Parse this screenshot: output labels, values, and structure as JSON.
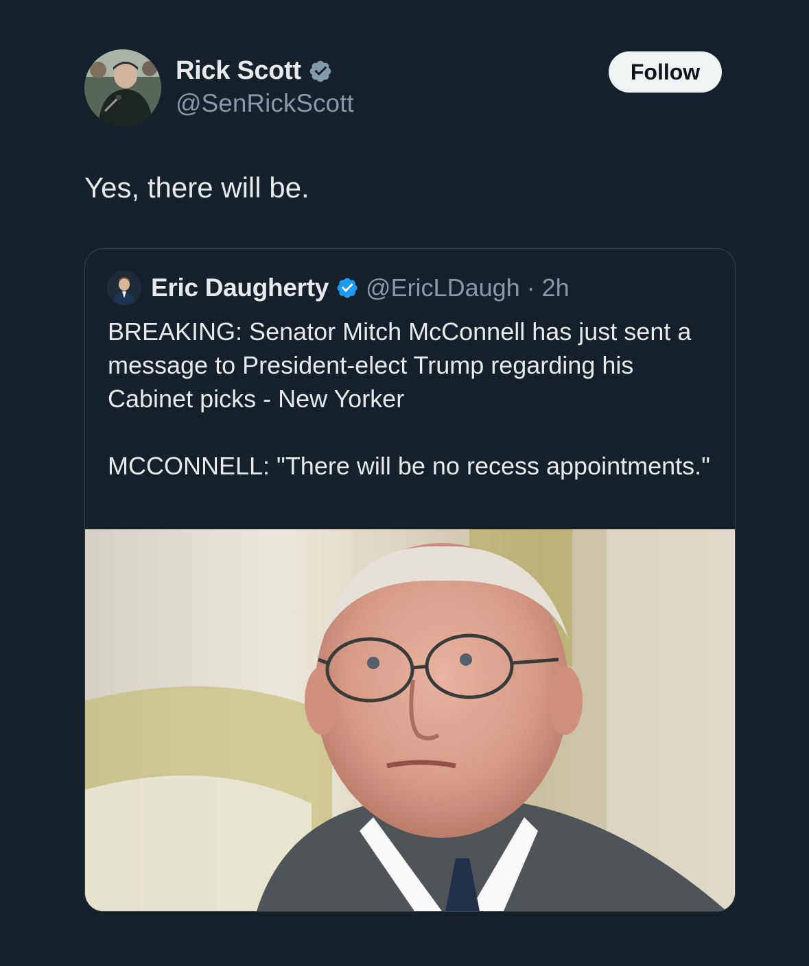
{
  "author": {
    "name": "Rick Scott",
    "handle": "@SenRickScott",
    "verified_badge": "gray-verified-badge-icon",
    "avatar": "avatar-photo"
  },
  "follow_button": {
    "label": "Follow"
  },
  "tweet": {
    "text": "Yes, there will be."
  },
  "quoted_tweet": {
    "author_name": "Eric Daugherty",
    "handle": "@EricLDaugh",
    "separator": "·",
    "time": "2h",
    "verified_badge": "blue-verified-badge-icon",
    "paragraphs": [
      "BREAKING: Senator Mitch McConnell has just sent a message to President-elect Trump regarding his Cabinet picks - New Yorker",
      "MCCONNELL: \"There will be no recess appointments.\""
    ],
    "image": "photo-of-older-man-with-glasses"
  },
  "colors": {
    "background": "#16202a",
    "text": "#e7e9ea",
    "secondary_text": "#8b98a5",
    "border": "#38444d",
    "follow_bg": "#eff3f4",
    "verified_blue": "#1d9bf0",
    "verified_gray": "#829aab"
  }
}
